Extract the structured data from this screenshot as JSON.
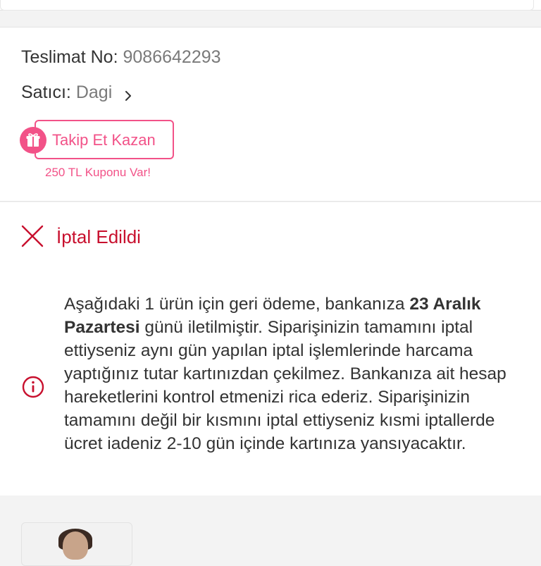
{
  "delivery": {
    "label": "Teslimat No:",
    "value": "9086642293"
  },
  "seller": {
    "label": "Satıcı:",
    "value": "Dagi",
    "icon": "chevron-right-icon"
  },
  "follow": {
    "button_label": "Takip Et Kazan",
    "icon": "gift-icon",
    "coupon_text": "250 TL Kuponu Var!",
    "accent_color": "#f25288"
  },
  "status": {
    "icon": "close-x-icon",
    "label": "İptal Edildi",
    "color": "#c8102e"
  },
  "notice": {
    "icon": "info-icon",
    "part1": "Aşağıdaki 1 ürün için geri ödeme, bankanıza ",
    "bold": "23 Aralık Pazartesi",
    "part2": " günü iletilmiştir. Siparişinizin tamamını iptal ettiyseniz aynı gün yapılan iptal işlemlerinde harcama yaptığınız tutar kartınızdan çekilmez. Bankanıza ait hesap hareketlerini kontrol etmenizi rica ederiz. Siparişinizin tamamını değil bir kısmını iptal ettiyseniz kısmi iptallerde ücret iadeniz 2-10 gün içinde kartınıza yansıyacaktır."
  }
}
